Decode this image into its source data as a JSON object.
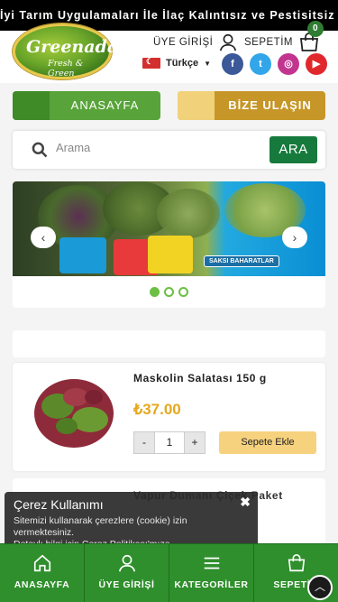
{
  "marquee": {
    "text": "İyi Tarım Uygulamaları İle İlaç Kalıntısız ve Pestisitsiz Ür..."
  },
  "header": {
    "logo_brand": "Greenada",
    "logo_tagline": "Fresh & Green",
    "uye_giris": "ÜYE GİRİŞİ",
    "sepetim": "SEPETİM",
    "cart_count": "0",
    "language": "Türkçe",
    "socials": [
      {
        "name": "facebook",
        "glyph": "f",
        "color": "#3b5998"
      },
      {
        "name": "twitter",
        "glyph": "t",
        "color": "#33a6ea"
      },
      {
        "name": "instagram",
        "glyph": "◎",
        "color": "#c1358f"
      },
      {
        "name": "youtube",
        "glyph": "▶",
        "color": "#e0282c"
      }
    ]
  },
  "nav": {
    "home": "ANASAYFA",
    "contact": "BİZE ULAŞIN"
  },
  "search": {
    "placeholder": "Arama",
    "button": "ARA"
  },
  "banner": {
    "badge": "SAKSI BAHARATLAR",
    "slide_count": 3,
    "active_slide": 1
  },
  "products": [
    {
      "name": "Maskolin Salatası 150 g",
      "currency": "₺",
      "price": "37.00",
      "qty": "1",
      "add": "Sepete Ekle"
    },
    {
      "name": "Vapur Dumanı Çiçek Paket"
    }
  ],
  "cookie": {
    "title": "Çerez Kullanımı",
    "body": "Sitemizi kullanarak çerezlere (cookie) izin vermektesiniz.",
    "more": "Detaylı bilgi için Çerez Politikası'mıza"
  },
  "bottom_nav": [
    {
      "label": "ANASAYFA",
      "icon": "home-icon"
    },
    {
      "label": "ÜYE GİRİŞİ",
      "icon": "user-icon"
    },
    {
      "label": "KATEGORİLER",
      "icon": "menu-icon"
    },
    {
      "label": "SEPETİM",
      "icon": "cart-icon"
    }
  ],
  "colors": {
    "green": "#2f8f2c",
    "accent": "#e5a81c",
    "dark_green_btn": "#167a3c"
  }
}
